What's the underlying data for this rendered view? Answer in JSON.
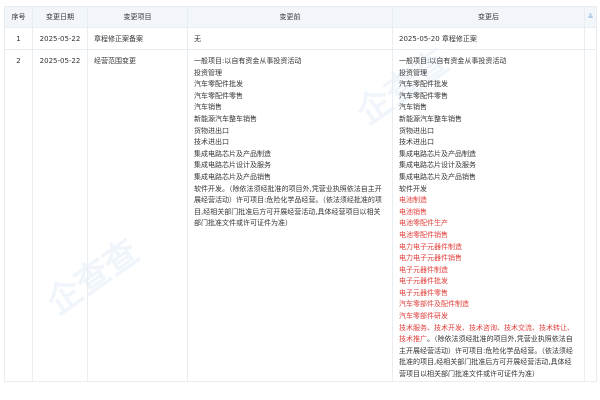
{
  "headers": {
    "no": "序号",
    "date": "变更日期",
    "item": "变更项目",
    "before": "变更前",
    "after": "变更后",
    "toggle": "≚"
  },
  "rows": [
    {
      "no": "1",
      "date": "2025-05-22",
      "item": "章程修正案备案",
      "before": "无",
      "after": "2025-05-20 章程修正案"
    },
    {
      "no": "2",
      "date": "2025-05-22",
      "item": "经营范围变更",
      "before_items": [
        "一般项目:以自有资金从事投资活动",
        "投资管理",
        "汽车零配件批发",
        "汽车零配件零售",
        "汽车销售",
        "新能源汽车整车销售",
        "货物进出口",
        "技术进出口",
        "集成电路芯片及产品制造",
        "集成电路芯片设计及服务",
        "集成电路芯片及产品销售"
      ],
      "before_note": "软件开发。（除依法须经批准的项目外,凭营业执照依法自主开展经营活动）许可项目:危险化学品经营。（依法须经批准的项目,经相关部门批准后方可开展经营活动,具体经营项目以相关部门批准文件或许可证件为准）",
      "after_items": [
        "一般项目:以自有资金从事投资活动",
        "投资管理",
        "汽车零配件批发",
        "汽车零配件零售",
        "汽车销售",
        "新能源汽车整车销售",
        "货物进出口",
        "技术进出口",
        "集成电路芯片及产品制造",
        "集成电路芯片设计及服务",
        "集成电路芯片及产品销售",
        "软件开发"
      ],
      "after_red_items": [
        "电池制造",
        "电池销售",
        "电池零配件生产",
        "电池零配件销售",
        "电力电子元器件制造",
        "电力电子元器件销售",
        "电子元器件制造",
        "电子元器件批发",
        "电子元器件零售",
        "汽车零部件及配件制造",
        "汽车零部件研发"
      ],
      "after_red_tail": "技术服务、技术开发、技术咨询、技术交流、技术转让、技术推广",
      "after_note": "。（除依法须经批准的项目外,凭营业执照依法自主开展经营活动）许可项目:危险化学品经营。（依法须经批准的项目,经相关部门批准后方可开展经营活动,具体经营项目以相关部门批准文件或许可证件为准）"
    }
  ],
  "watermark": "企查查 Qcc.com",
  "colors": {
    "header_bg": "#f2f6fa",
    "added_text": "#e0403c",
    "border": "#e8edf2"
  }
}
